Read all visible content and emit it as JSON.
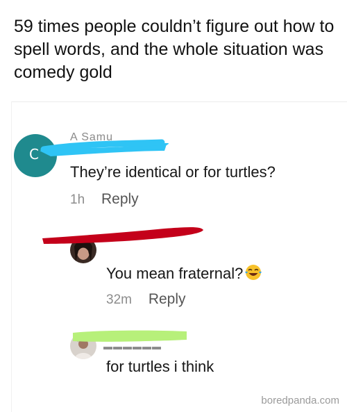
{
  "headline": "59 times people couldn’t figure out how to spell words, and the whole situation was comedy gold",
  "comments": [
    {
      "avatar_letter": "C",
      "username_fragment": "A Samu",
      "text": "They’re identical or for turtles?",
      "time": "1h",
      "reply_label": "Reply"
    },
    {
      "text": "You mean fraternal?",
      "emoji": "tears-of-joy",
      "time": "32m",
      "reply_label": "Reply"
    },
    {
      "text": "for turtles i think"
    }
  ],
  "watermark": "boredpanda.com",
  "colors": {
    "avatar_teal": "#1f8a8e",
    "scribble_blue": "#2fc4f5",
    "scribble_red": "#c4001a",
    "scribble_green": "#b7f07a",
    "muted_text": "#8c8c8c"
  }
}
